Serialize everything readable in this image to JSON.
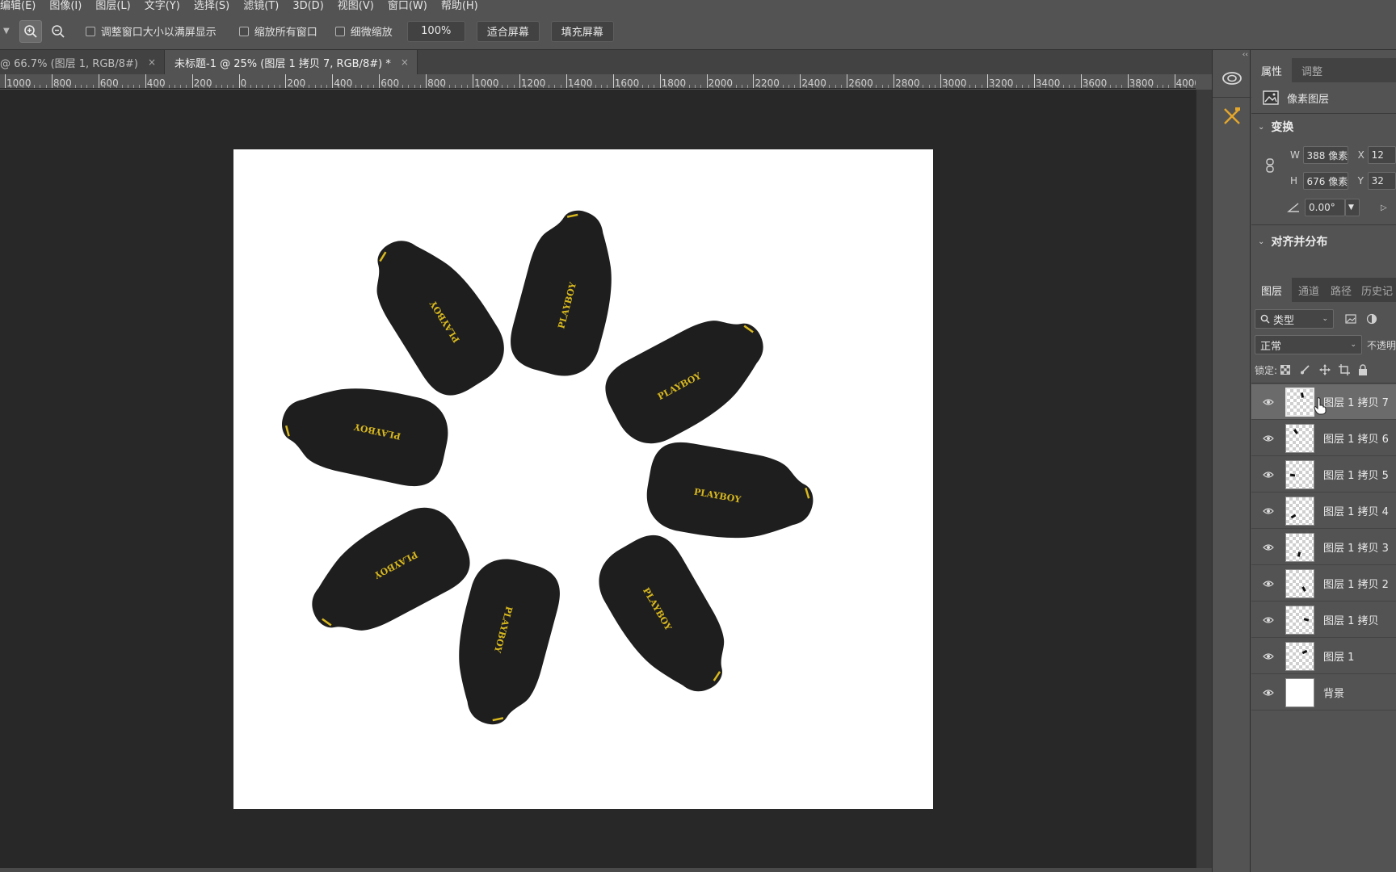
{
  "menu": [
    "编辑(E)",
    "图像(I)",
    "图层(L)",
    "文字(Y)",
    "选择(S)",
    "滤镜(T)",
    "3D(D)",
    "视图(V)",
    "窗口(W)",
    "帮助(H)"
  ],
  "options": {
    "resize_windows": "调整窗口大小以满屏显示",
    "zoom_all": "缩放所有窗口",
    "scrubby_zoom": "细微缩放",
    "zoom_percent": "100%",
    "fit_screen": "适合屏幕",
    "fill_screen": "填充屏幕"
  },
  "tabs": [
    {
      "label": "@ 66.7% (图层 1, RGB/8#)",
      "close": "×",
      "active": false
    },
    {
      "label": "未标题-1 @ 25% (图层 1 拷贝 7, RGB/8#) *",
      "close": "×",
      "active": true
    }
  ],
  "ruler_ticks": [
    "1000",
    "800",
    "600",
    "400",
    "200",
    "0",
    "200",
    "400",
    "600",
    "800",
    "1000",
    "1200",
    "1400",
    "1600",
    "1800",
    "2000",
    "2200",
    "2400",
    "2600",
    "2800",
    "3000",
    "3200",
    "3400",
    "3600",
    "3800",
    "4000"
  ],
  "canvas": {
    "sock_brand": "PLAYBOY",
    "sock_color": "#1e1e1e",
    "accent_color": "#d8b81e",
    "background": "#ffffff"
  },
  "iconstrip": {
    "collapse": "‹‹",
    "icons": [
      "cloud-libraries-icon",
      "tools-icon"
    ]
  },
  "properties": {
    "tabs": [
      "属性",
      "调整"
    ],
    "layer_type": "像素图层",
    "transform_title": "变换",
    "w_label": "W",
    "w_value": "388 像素",
    "h_label": "H",
    "h_value": "676 像素",
    "x_label": "X",
    "x_value": "12",
    "y_label": "Y",
    "y_value": "32",
    "angle_value": "0.00°",
    "align_title": "对齐并分布"
  },
  "layers_panel": {
    "tabs": [
      "图层",
      "通道",
      "路径",
      "历史记"
    ],
    "filter_kind": "类型",
    "blend_mode": "正常",
    "opacity_label": "不透明",
    "lock_label": "锁定:",
    "layers": [
      {
        "name": "图层 1 拷贝 7",
        "selected": true,
        "transparent": true
      },
      {
        "name": "图层 1 拷贝 6",
        "selected": false,
        "transparent": true
      },
      {
        "name": "图层 1 拷贝 5",
        "selected": false,
        "transparent": true
      },
      {
        "name": "图层 1 拷贝 4",
        "selected": false,
        "transparent": true
      },
      {
        "name": "图层 1 拷贝 3",
        "selected": false,
        "transparent": true
      },
      {
        "name": "图层 1 拷贝 2",
        "selected": false,
        "transparent": true
      },
      {
        "name": "图层 1 拷贝",
        "selected": false,
        "transparent": true
      },
      {
        "name": "图层 1",
        "selected": false,
        "transparent": true
      },
      {
        "name": "背景",
        "selected": false,
        "transparent": false
      }
    ]
  }
}
